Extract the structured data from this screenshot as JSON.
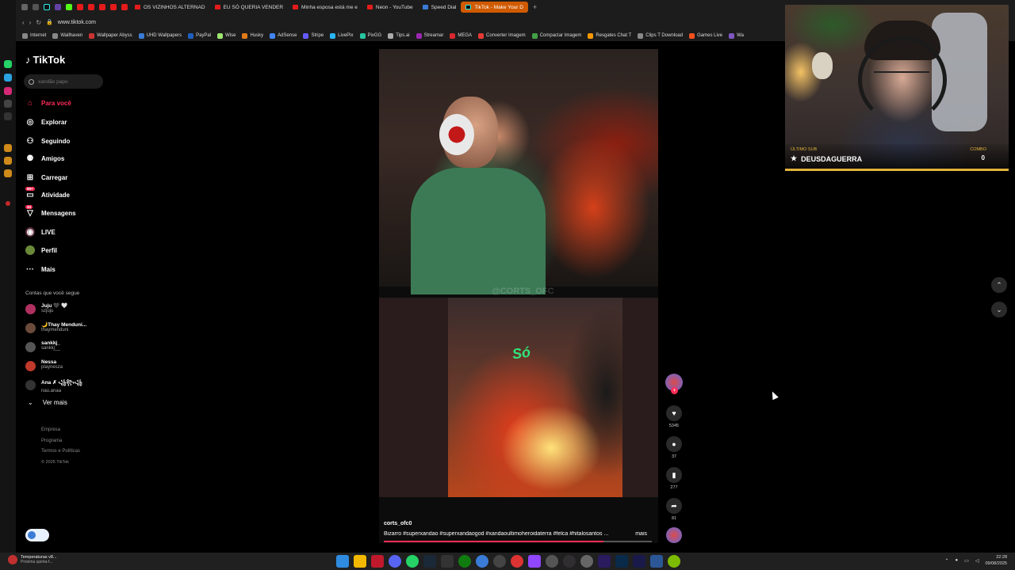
{
  "browser": {
    "tabs": [
      {
        "label": "OS VIZINHOS ALTERNAD",
        "type": "yt"
      },
      {
        "label": "EU SÓ QUERIA VENDER",
        "type": "yt"
      },
      {
        "label": "Minha esposa está me e",
        "type": "yt"
      },
      {
        "label": "Neon - YouTube",
        "type": "yt"
      },
      {
        "label": "Speed Dial",
        "type": "sd"
      },
      {
        "label": "TikTok - Make Your D",
        "type": "tt",
        "active": true
      }
    ],
    "new_tab": "+",
    "url": "www.tiktok.com",
    "bookmarks": [
      {
        "label": "Internet",
        "color": "#888888"
      },
      {
        "label": "Wallhaven",
        "color": "#888888"
      },
      {
        "label": "Wallpaper Abyss",
        "color": "#cc3333"
      },
      {
        "label": "UHD Wallpapers",
        "color": "#3a7bd5"
      },
      {
        "label": "PayPal",
        "color": "#1f5fbf"
      },
      {
        "label": "Wise",
        "color": "#9fe870"
      },
      {
        "label": "Husky",
        "color": "#e07b1a"
      },
      {
        "label": "AdSense",
        "color": "#4285f4"
      },
      {
        "label": "Stripe",
        "color": "#635bff"
      },
      {
        "label": "LivePix",
        "color": "#29b6f6"
      },
      {
        "label": "PixGG",
        "color": "#26c6a0"
      },
      {
        "label": "Tips.ai",
        "color": "#aaaaaa"
      },
      {
        "label": "Streamar",
        "color": "#9c27b0"
      },
      {
        "label": "MEGA",
        "color": "#d9272e"
      },
      {
        "label": "Converter Imagem",
        "color": "#e53935"
      },
      {
        "label": "Compactar Imagem",
        "color": "#43a047"
      },
      {
        "label": "Resgates Chat T",
        "color": "#ff9800"
      },
      {
        "label": "Clips T Download",
        "color": "#888888"
      },
      {
        "label": "Games Live",
        "color": "#f4511e"
      },
      {
        "label": "Wa",
        "color": "#7e57c2"
      }
    ]
  },
  "tiktok": {
    "logo": "TikTok",
    "search_placeholder": "xandão papo",
    "nav": [
      {
        "label": "Para você",
        "icon": "home-icon",
        "active": true
      },
      {
        "label": "Explorar",
        "icon": "compass-icon"
      },
      {
        "label": "Seguindo",
        "icon": "following-icon"
      },
      {
        "label": "Amigos",
        "icon": "friends-icon"
      },
      {
        "label": "Carregar",
        "icon": "upload-icon"
      },
      {
        "label": "Atividade",
        "icon": "activity-icon",
        "badge": "99+"
      },
      {
        "label": "Mensagens",
        "icon": "messages-icon",
        "badge": "34"
      },
      {
        "label": "LIVE",
        "icon": "live-icon"
      },
      {
        "label": "Perfil",
        "icon": "profile-icon"
      },
      {
        "label": "Mais",
        "icon": "more-icon"
      }
    ],
    "following_title": "Contas que você segue",
    "following": [
      {
        "name": "Juju 🖤 🤍",
        "handle": "szjuju",
        "color": "#b03060"
      },
      {
        "name": "🌙Thay Menduni...",
        "handle": "thaymenduni",
        "color": "#6a4a3a"
      },
      {
        "name": "sankkj_",
        "handle": "sankkj__",
        "color": "#555555"
      },
      {
        "name": "Nessa",
        "handle": "playnesza",
        "color": "#c0392b"
      },
      {
        "name": "Ana ✗ ꧁꧂꧁",
        "handle": "nau.anaa",
        "color": "#333333"
      }
    ],
    "see_more": "Ver mais",
    "footer": [
      "Empresa",
      "Programa",
      "Termos e Políticas"
    ],
    "copyright": "© 2025 TikTok"
  },
  "video": {
    "watermark": "@CORTS_OFC",
    "overlay_text": "Só",
    "author": "corts_ofc0",
    "caption": "Bizarro #superxandao #superxandaogod #xandaoultimoheroidaterra #felca #hitalosantos ...",
    "more_label": "mais",
    "progress": 0.82,
    "likes": "5345",
    "comments": "37",
    "saves": "277",
    "shares": "81"
  },
  "stream_overlay": {
    "last_sub_label": "ÚLTIMO SUB",
    "last_sub_name": "DEUSDAGUERRA",
    "combo_label": "COMBO",
    "combo_value": "0"
  },
  "taskbar": {
    "weather_line1": "Temperaturas v8...",
    "weather_line2": "Próxima quinta-f...",
    "time": "22:28",
    "date": "09/08/2025"
  }
}
